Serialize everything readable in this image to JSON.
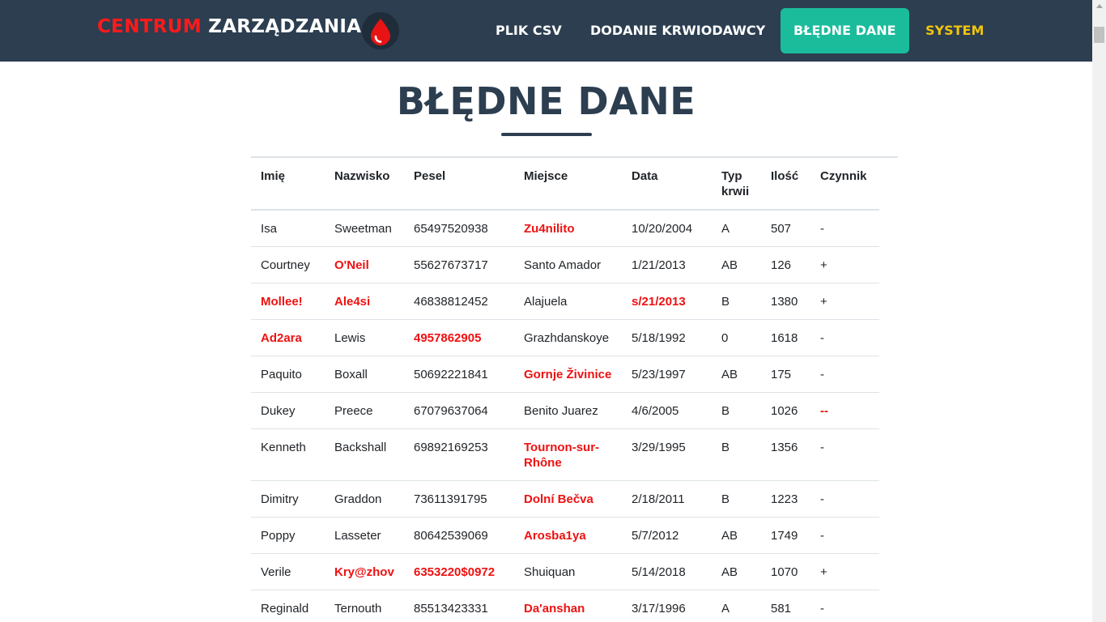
{
  "nav": {
    "brand_red": "CENTRUM",
    "brand_white": "ZARZĄDZANIA",
    "logo_icon": "blood-drop-icon",
    "items": [
      {
        "label": "PLIK CSV"
      },
      {
        "label": "DODANIE KRWIODAWCY"
      },
      {
        "label": "BŁĘDNE DANE",
        "active": true
      },
      {
        "label": "SYSTEM"
      }
    ]
  },
  "colors": {
    "navbar": "#2c3e50",
    "brand_red": "#ff1a1a",
    "active_tab": "#1abc9c",
    "system_link": "#f1c40f",
    "error_text": "#ee1111"
  },
  "page": {
    "title": "BŁĘDNE DANE"
  },
  "table": {
    "headers": [
      "Imię",
      "Nazwisko",
      "Pesel",
      "Miejsce",
      "Data",
      "Typ krwii",
      "Ilość",
      "Czynnik"
    ],
    "rows": [
      {
        "cells": [
          "Isa",
          "Sweetman",
          "65497520938",
          "Zu4nilito",
          "10/20/2004",
          "A",
          "507",
          "-"
        ],
        "errors": [
          3
        ]
      },
      {
        "cells": [
          "Courtney",
          "O'Neil",
          "55627673717",
          "Santo Amador",
          "1/21/2013",
          "AB",
          "126",
          "+"
        ],
        "errors": [
          1
        ]
      },
      {
        "cells": [
          "Mollee!",
          "Ale4si",
          "46838812452",
          "Alajuela",
          "s/21/2013",
          "B",
          "1380",
          "+"
        ],
        "errors": [
          0,
          1,
          4
        ]
      },
      {
        "cells": [
          "Ad2ara",
          "Lewis",
          "4957862905",
          "Grazhdanskoye",
          "5/18/1992",
          "0",
          "1618",
          "-"
        ],
        "errors": [
          0,
          2
        ]
      },
      {
        "cells": [
          "Paquito",
          "Boxall",
          "50692221841",
          "Gornje Živinice",
          "5/23/1997",
          "AB",
          "175",
          "-"
        ],
        "errors": [
          3
        ]
      },
      {
        "cells": [
          "Dukey",
          "Preece",
          "67079637064",
          "Benito Juarez",
          "4/6/2005",
          "B",
          "1026",
          "--"
        ],
        "errors": [
          7
        ]
      },
      {
        "cells": [
          "Kenneth",
          "Backshall",
          "69892169253",
          "Tournon-sur-Rhône",
          "3/29/1995",
          "B",
          "1356",
          "-"
        ],
        "errors": [
          3
        ]
      },
      {
        "cells": [
          "Dimitry",
          "Graddon",
          "73611391795",
          "Dolní Bečva",
          "2/18/2011",
          "B",
          "1223",
          "-"
        ],
        "errors": [
          3
        ]
      },
      {
        "cells": [
          "Poppy",
          "Lasseter",
          "80642539069",
          "Arosba1ya",
          "5/7/2012",
          "AB",
          "1749",
          "-"
        ],
        "errors": [
          3
        ]
      },
      {
        "cells": [
          "Verile",
          "Kry@zhov",
          "6353220$0972",
          "Shuiquan",
          "5/14/2018",
          "AB",
          "1070",
          "+"
        ],
        "errors": [
          1,
          2
        ]
      },
      {
        "cells": [
          "Reginald",
          "Ternouth",
          "85513423331",
          "Da'anshan",
          "3/17/1996",
          "A",
          "581",
          "-"
        ],
        "errors": [
          3
        ]
      }
    ]
  }
}
